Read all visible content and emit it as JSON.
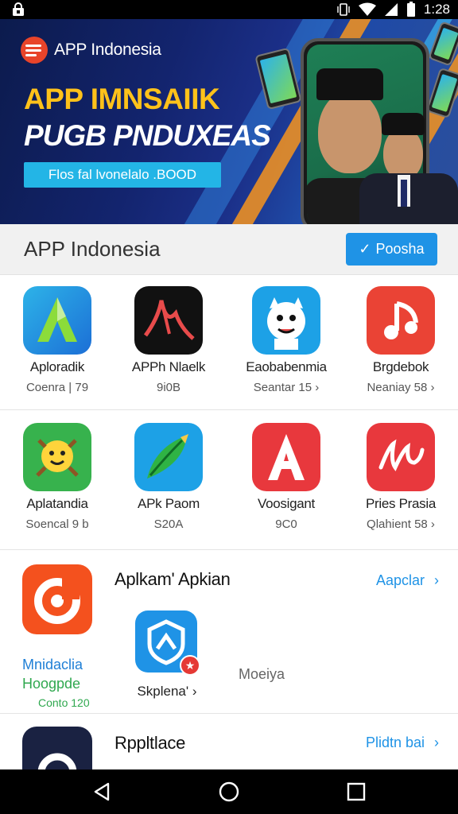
{
  "status_bar": {
    "time": "1:28"
  },
  "banner": {
    "brand_name": "APP Indonesia",
    "headline_1": "APP IMNSAIIK",
    "headline_2": "PUGB PNDUXEAS",
    "cta_text": "Flos fal lvonelalo .BOOD"
  },
  "section": {
    "title": "APP Indonesia",
    "button_label": "Poosha",
    "button_check": "✓"
  },
  "grid_rows": [
    [
      {
        "name": "Aploradik",
        "meta": "Coenra | 79"
      },
      {
        "name": "APPh Nlaelk",
        "meta": "9i0B"
      },
      {
        "name": "Eaobabenmia",
        "meta": "Seantar 15 ›"
      },
      {
        "name": "Brgdebok",
        "meta": "Neaniay 58 ›"
      }
    ],
    [
      {
        "name": "Aplatandia",
        "meta": "Soencal 9 b"
      },
      {
        "name": "APk Paom",
        "meta": "S20A"
      },
      {
        "name": "Voosigant",
        "meta": "9C0"
      },
      {
        "name": "Pries Prasia",
        "meta": "Qlahient 58 ›"
      }
    ]
  ],
  "list_section_1": {
    "title": "Aplkam' Apkian",
    "link": "Aapclar",
    "side_line_1": "Mnidaclia",
    "side_line_2": "Hoogpde",
    "side_line_3": "Conto 120",
    "sub_app_name": "Skplena' ›",
    "sub_text": "Moeiya"
  },
  "list_section_2": {
    "title": "Rppltlace",
    "link": "Plidtn bai"
  },
  "colors": {
    "accent_blue": "#1f93e6",
    "banner_yellow": "#ffc21a",
    "cta_cyan": "#23b5e6"
  }
}
